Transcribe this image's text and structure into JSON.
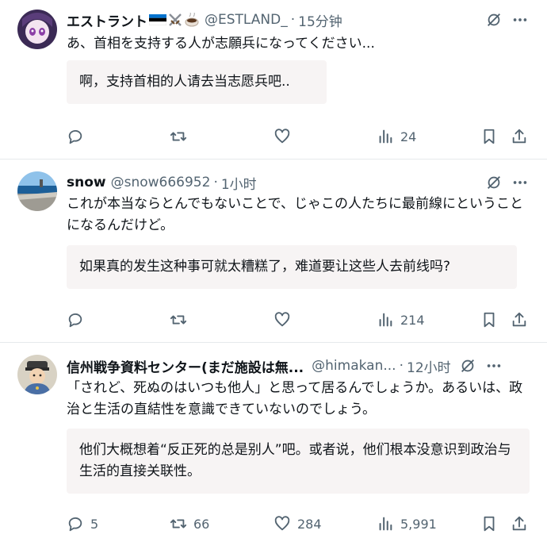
{
  "posts": [
    {
      "name": "エストラント",
      "handle": "@ESTLAND_",
      "time": "15分钟",
      "text": "あ、首相を支持する人が志願兵になってくださいまし",
      "text_display": "あ、首相を支持する人が志願兵になってください...",
      "translation": "啊，支持首相的人请去当志愿兵吧..",
      "stats": {
        "reply": "",
        "repost": "",
        "like": "",
        "views": "24"
      }
    },
    {
      "name": "snow",
      "handle": "@snow666952",
      "time": "1小时",
      "text": "これが本当ならとんでもないことで、じゃこの人たちに最前線にということになるんだけど。",
      "translation": "如果真的发生这种事可就太糟糕了，难道要让这些人去前线吗?",
      "stats": {
        "reply": "",
        "repost": "",
        "like": "",
        "views": "214"
      }
    },
    {
      "name": "信州戦争資料センター(まだ施設は無...",
      "handle": "@himakan...",
      "time": "12小时",
      "text": "「されど、死ぬのはいつも他人」と思って居るんでしょうか。あるいは、政治と生活の直結性を意識できていないのでしょう。",
      "translation": "他们大概想着“反正死的总是别人”吧。或者说，他们根本没意识到政治与生活的直接关联性。",
      "stats": {
        "reply": "5",
        "repost": "66",
        "like": "284",
        "views": "5,991"
      }
    }
  ],
  "colors": {
    "muted": "#536471",
    "text": "#0f1419",
    "translation_bg": "#f7f4f4",
    "divider": "#e6e9ec"
  },
  "icons": [
    "reply-icon",
    "repost-icon",
    "like-icon",
    "views-icon",
    "bookmark-icon",
    "share-icon",
    "grok-icon",
    "more-icon"
  ]
}
